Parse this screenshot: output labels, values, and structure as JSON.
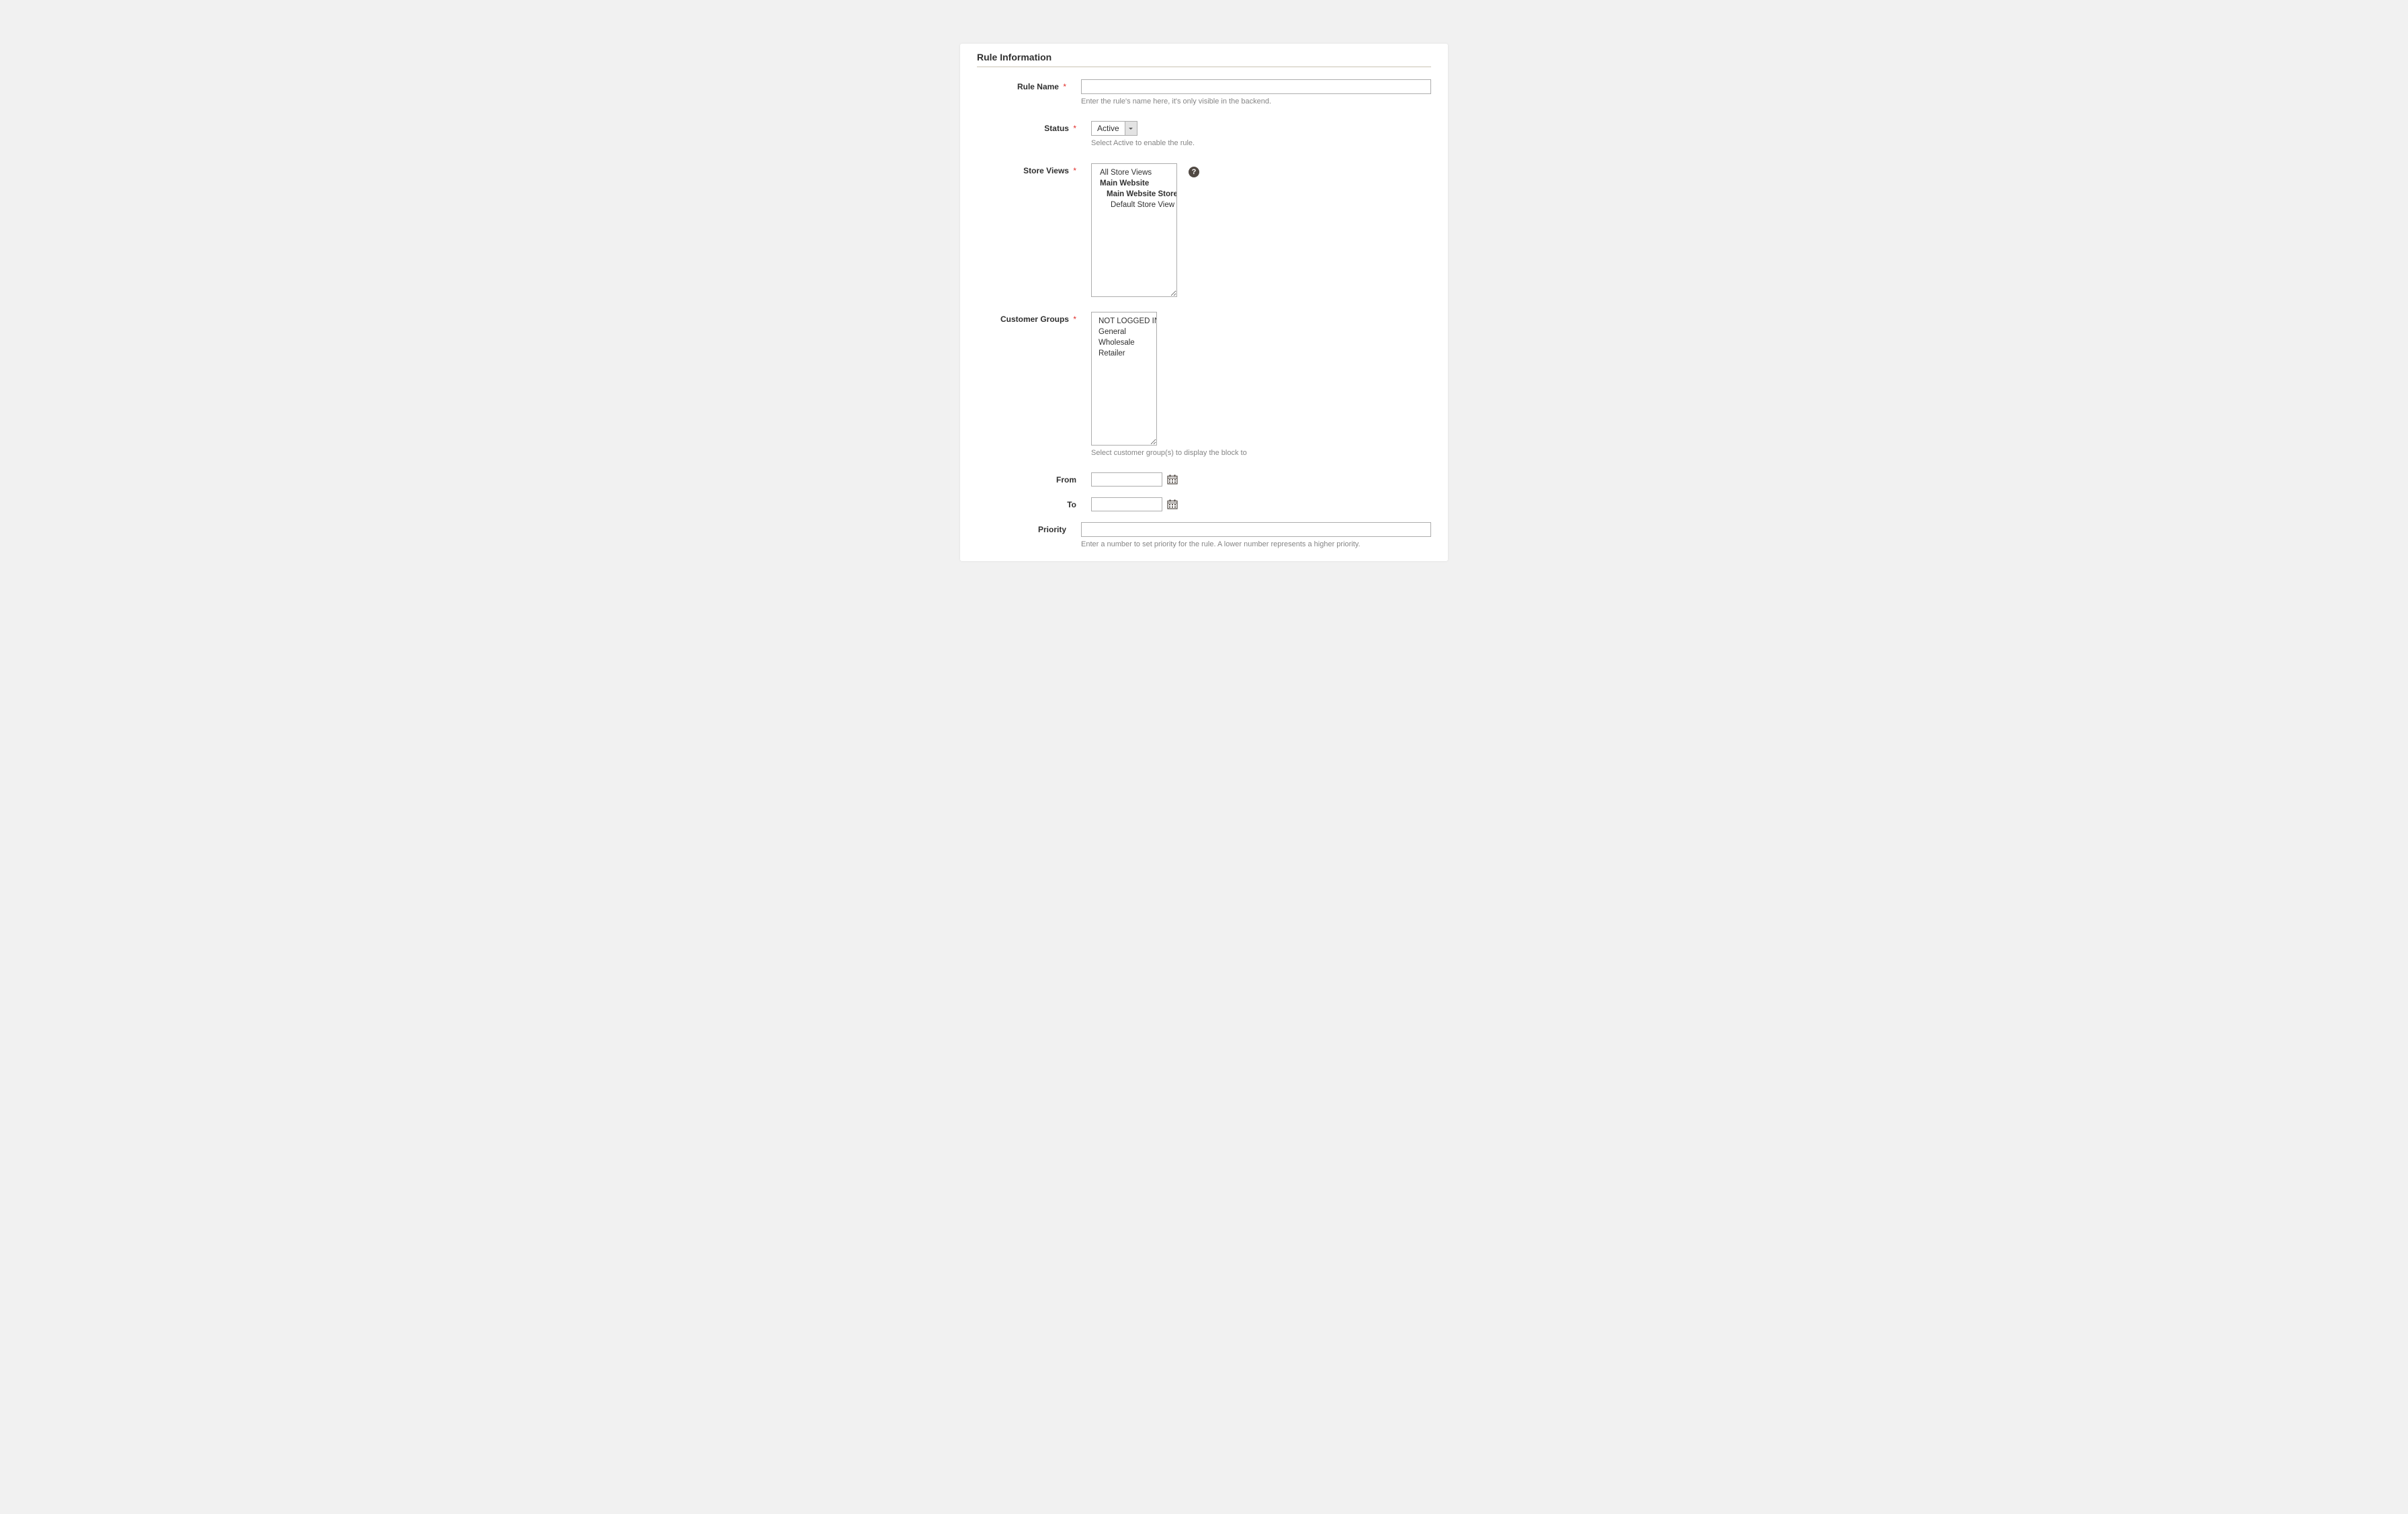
{
  "section": {
    "title": "Rule Information"
  },
  "fields": {
    "rule_name": {
      "label": "Rule Name",
      "value": "",
      "helper": "Enter the rule's name here, it's only visible in the backend."
    },
    "status": {
      "label": "Status",
      "value": "Active",
      "helper": "Select Active to enable the rule."
    },
    "store_views": {
      "label": "Store Views",
      "options": [
        {
          "text": "All Store Views",
          "indent": 0
        },
        {
          "text": "Main Website",
          "indent": 1
        },
        {
          "text": "Main Website Store",
          "indent": 2
        },
        {
          "text": "Default Store View",
          "indent": 3
        }
      ],
      "tooltip": "?"
    },
    "customer_groups": {
      "label": "Customer Groups",
      "options": [
        {
          "text": "NOT LOGGED IN"
        },
        {
          "text": "General"
        },
        {
          "text": "Wholesale"
        },
        {
          "text": "Retailer"
        }
      ],
      "helper": "Select customer group(s) to display the block to"
    },
    "from": {
      "label": "From",
      "value": ""
    },
    "to": {
      "label": "To",
      "value": ""
    },
    "priority": {
      "label": "Priority",
      "value": "",
      "helper": "Enter a number to set priority for the rule. A lower number represents a higher priority."
    }
  }
}
